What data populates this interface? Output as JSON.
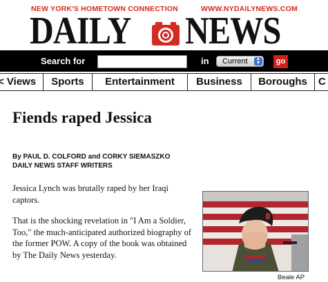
{
  "header": {
    "tagline_left": "NEW YORK'S HOMETOWN CONNECTION",
    "tagline_right": "WWW.NYDAILYNEWS.COM",
    "logo_left": "DAILY",
    "logo_right": "NEWS",
    "accent_color": "#d22b1f"
  },
  "search": {
    "label": "Search for",
    "input_value": "",
    "in_label": "in",
    "scope_selected": "Current",
    "go_label": "go"
  },
  "nav": {
    "items": [
      {
        "label": "Views",
        "display": "< Views"
      },
      {
        "label": "Sports"
      },
      {
        "label": "Entertainment"
      },
      {
        "label": "Business"
      },
      {
        "label": "Boroughs"
      },
      {
        "label": "C"
      }
    ]
  },
  "article": {
    "headline": "Fiends raped Jessica",
    "byline_1": "By PAUL D. COLFORD and CORKY SIEMASZKO",
    "byline_2": "DAILY NEWS STAFF WRITERS",
    "paragraphs": [
      "Jessica Lynch was brutally raped by her Iraqi captors.",
      "That is the shocking revelation in \"I Am a Soldier, Too,\" the much-anticipated authorized biography of the former POW. A copy of the book was obtained by The Daily News yesterday."
    ],
    "photo_credit": "Beale AP"
  }
}
